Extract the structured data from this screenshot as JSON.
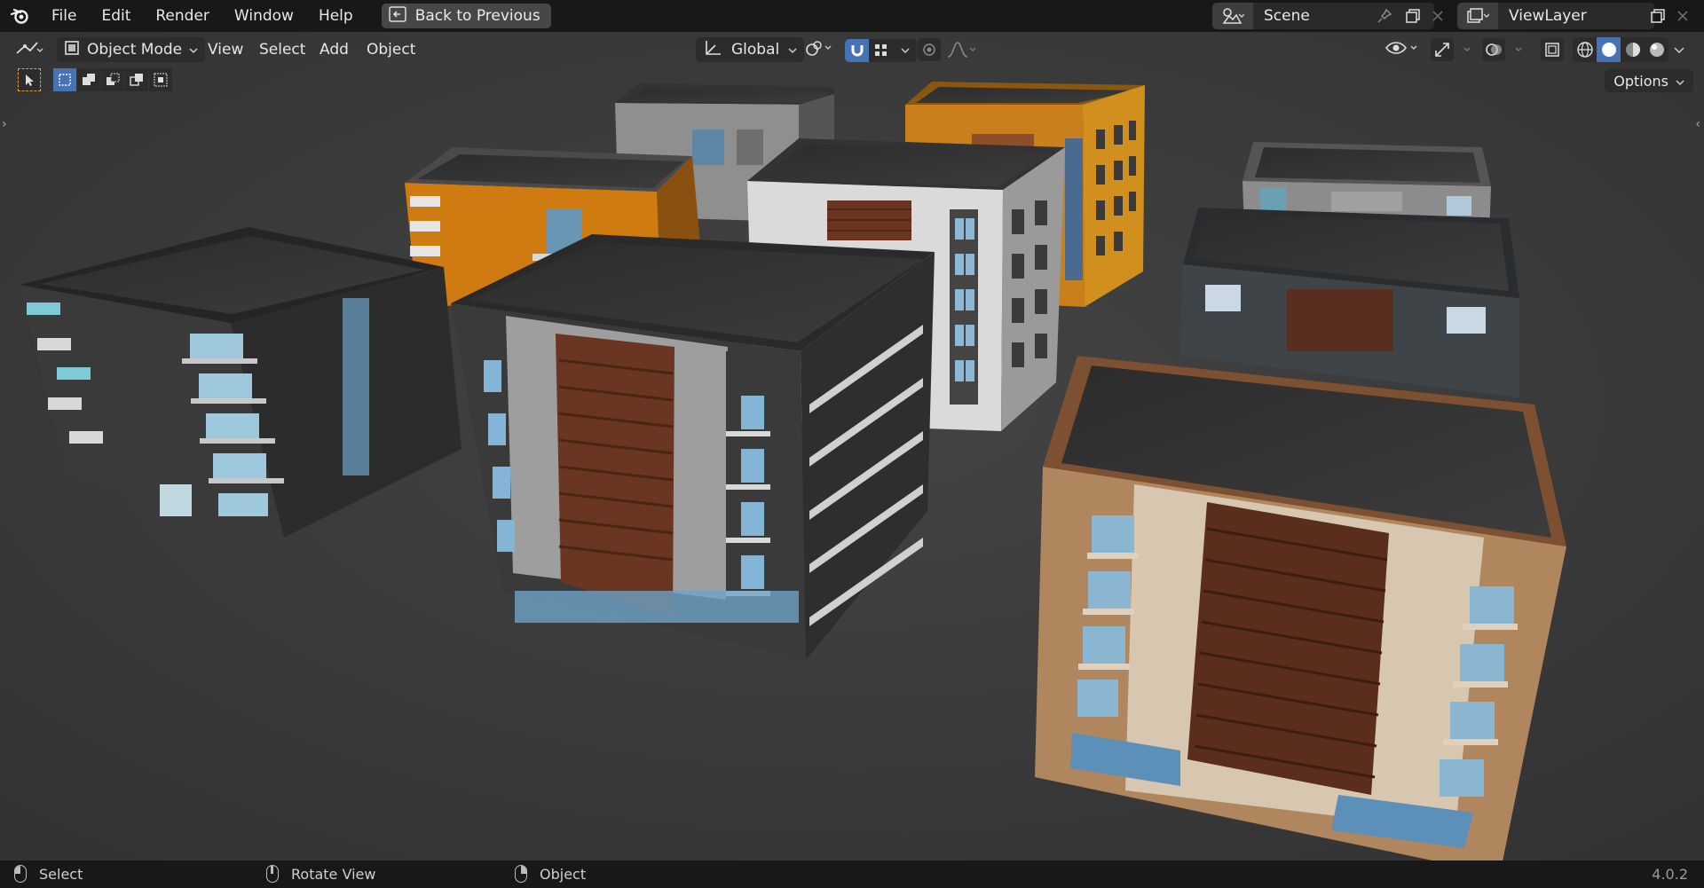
{
  "menu": {
    "file": "File",
    "edit": "Edit",
    "render": "Render",
    "window": "Window",
    "help": "Help",
    "back_to_previous": "Back to Previous"
  },
  "scene": {
    "label": "Scene"
  },
  "view_layer": {
    "label": "ViewLayer"
  },
  "header": {
    "mode": "Object Mode",
    "view": "View",
    "select": "Select",
    "add": "Add",
    "object": "Object",
    "transform_orientation": "Global",
    "options": "Options"
  },
  "status": {
    "left": "Select",
    "middle": "Rotate View",
    "right": "Object",
    "version": "4.0.2"
  },
  "colors": {
    "accent": "#4772b3",
    "topbar": "#181818",
    "viewport_bg": "#3a3a3a"
  }
}
